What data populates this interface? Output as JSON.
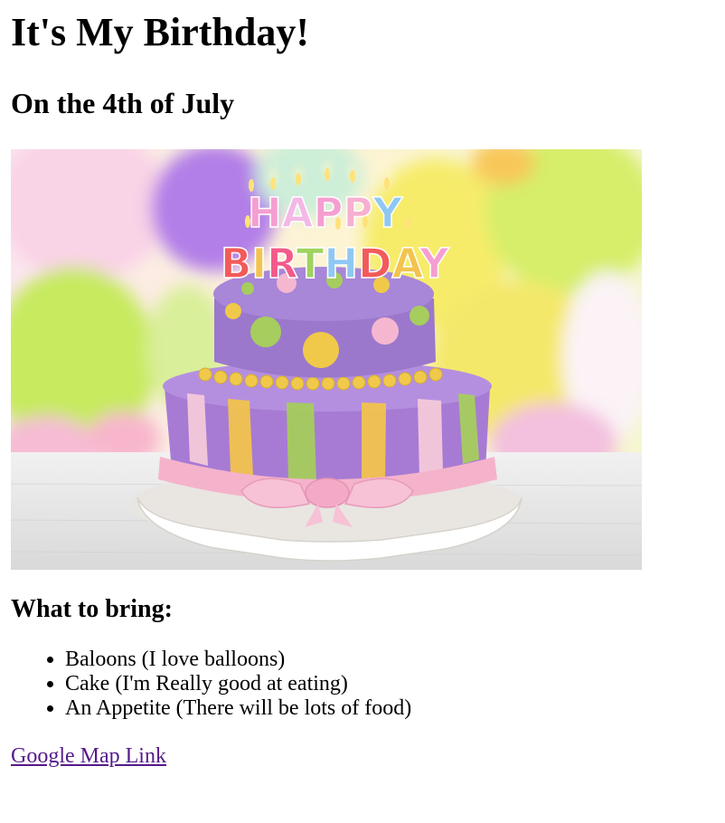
{
  "heading": "It's My Birthday!",
  "subheading": "On the 4th of July",
  "hero_image": {
    "cake_letters_top": "HAPPY",
    "cake_letters_bottom": "BIRTHDAY"
  },
  "bring_title": "What to bring:",
  "bring_items": [
    "Baloons (I love balloons)",
    "Cake (I'm Really good at eating)",
    "An Appetite (There will be lots of food)"
  ],
  "map_link": "Google Map Link",
  "colors": {
    "link_visited": "#551a8b",
    "text": "#000000",
    "background": "#ffffff"
  }
}
